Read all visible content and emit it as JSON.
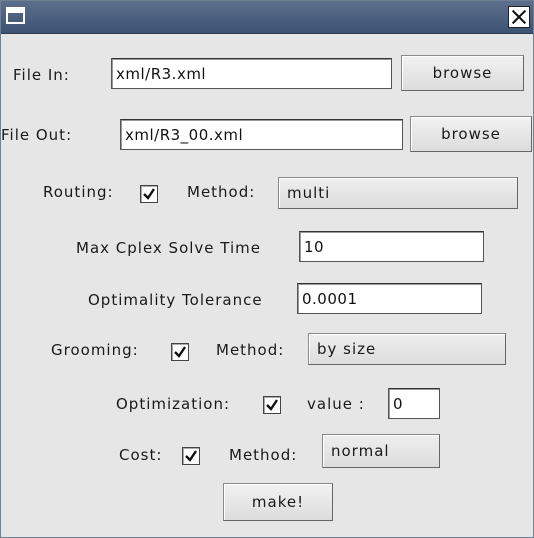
{
  "window": {
    "icon": "window-menu-icon",
    "close_icon": "close-icon"
  },
  "file_in": {
    "label": "File In:",
    "value": "xml/R3.xml",
    "browse_label": "browse"
  },
  "file_out": {
    "label": "File Out:",
    "value": "xml/R3_00.xml",
    "browse_label": "browse"
  },
  "routing": {
    "label": "Routing:",
    "checked": true,
    "method_label": "Method:",
    "method_value": "multi"
  },
  "max_cplex": {
    "label": "Max Cplex Solve Time",
    "value": "10"
  },
  "optimality": {
    "label": "Optimality Tolerance",
    "value": "0.0001"
  },
  "grooming": {
    "label": "Grooming:",
    "checked": true,
    "method_label": "Method:",
    "method_value": "by size"
  },
  "optimization": {
    "label": "Optimization:",
    "checked": true,
    "value_label": "value :",
    "value": "0"
  },
  "cost": {
    "label": "Cost:",
    "checked": true,
    "method_label": "Method:",
    "method_value": "normal"
  },
  "make_label": "make!"
}
